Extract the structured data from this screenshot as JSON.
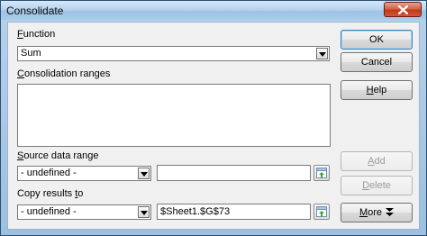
{
  "window": {
    "title": "Consolidate"
  },
  "function": {
    "label_accel": "F",
    "label_rest": "unction",
    "selected": "Sum"
  },
  "consolidation_ranges": {
    "label_accel": "C",
    "label_rest": "onsolidation ranges"
  },
  "source_data_range": {
    "label_accel": "S",
    "label_rest": "ource data range",
    "selected": "- undefined -",
    "value": ""
  },
  "copy_results_to": {
    "label_pre": "Copy results ",
    "label_accel": "t",
    "label_rest": "o",
    "selected": "- undefined -",
    "value": "$Sheet1.$G$73"
  },
  "buttons": {
    "ok": "OK",
    "cancel": "Cancel",
    "help_accel": "H",
    "help_rest": "elp",
    "add_accel": "A",
    "add_rest": "dd",
    "delete_accel": "D",
    "delete_rest": "elete",
    "more_accel": "M",
    "more_rest": "ore"
  },
  "icons": {
    "close": "close-icon",
    "dropdown": "chevron-down-icon",
    "shrink": "shrink-icon",
    "more": "double-chevron-down-icon"
  }
}
